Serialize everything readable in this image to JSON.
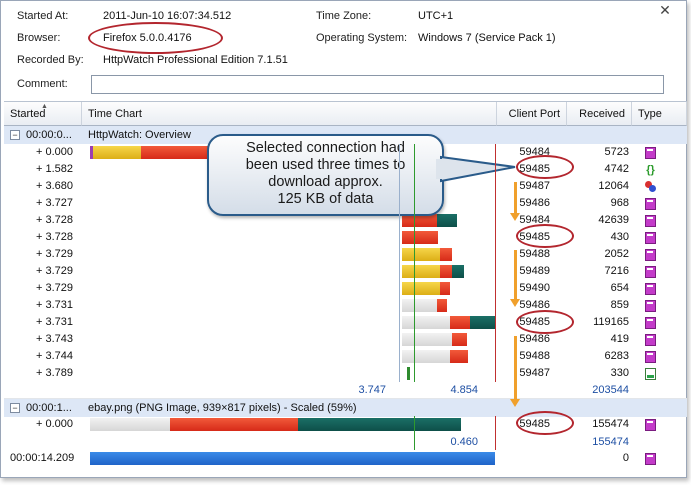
{
  "header": {
    "started_label": "Started At:",
    "started_value": "2011-Jun-10 16:07:34.512",
    "timezone_label": "Time Zone:",
    "timezone_value": "UTC+1",
    "browser_label": "Browser:",
    "browser_value": "Firefox 5.0.0.4176",
    "os_label": "Operating System:",
    "os_value": "Windows 7 (Service Pack 1)",
    "recorded_label": "Recorded By:",
    "recorded_value": "HttpWatch Professional Edition 7.1.51",
    "comment_label": "Comment:",
    "comment_value": ""
  },
  "columns": {
    "started": "Started",
    "timechart": "Time Chart",
    "port": "Client Port",
    "received": "Received",
    "type": "Type"
  },
  "group1": {
    "time": "00:00:0...",
    "title": "HttpWatch: Overview"
  },
  "rows1": [
    {
      "started": "+ 0.000",
      "port": "59484",
      "received": "5723",
      "type_icon": "page-icon"
    },
    {
      "started": "+ 1.582",
      "port": "59485",
      "received": "4742",
      "type_icon": "javascript-icon"
    },
    {
      "started": "+ 3.680",
      "port": "59487",
      "received": "12064",
      "type_icon": "css-icon"
    },
    {
      "started": "+ 3.727",
      "port": "59486",
      "received": "968",
      "type_icon": "image-icon"
    },
    {
      "started": "+ 3.728",
      "port": "59484",
      "received": "42639",
      "type_icon": "image-icon"
    },
    {
      "started": "+ 3.728",
      "port": "59485",
      "received": "430",
      "type_icon": "image-icon"
    },
    {
      "started": "+ 3.729",
      "port": "59488",
      "received": "2052",
      "type_icon": "image-icon"
    },
    {
      "started": "+ 3.729",
      "port": "59489",
      "received": "7216",
      "type_icon": "image-icon"
    },
    {
      "started": "+ 3.729",
      "port": "59490",
      "received": "654",
      "type_icon": "image-icon"
    },
    {
      "started": "+ 3.731",
      "port": "59486",
      "received": "859",
      "type_icon": "image-icon"
    },
    {
      "started": "+ 3.731",
      "port": "59485",
      "received": "119165",
      "type_icon": "image-icon"
    },
    {
      "started": "+ 3.743",
      "port": "59486",
      "received": "419",
      "type_icon": "image-icon"
    },
    {
      "started": "+ 3.744",
      "port": "59488",
      "received": "6283",
      "type_icon": "image-icon"
    },
    {
      "started": "+ 3.789",
      "port": "59487",
      "received": "330",
      "type_icon": "green-image-icon"
    }
  ],
  "summary1": {
    "load1": "3.747",
    "load2": "4.854",
    "received": "203544"
  },
  "group2": {
    "time": "00:00:1...",
    "title": "ebay.png (PNG Image, 939×817 pixels) - Scaled (59%)"
  },
  "rows2": [
    {
      "started": "+ 0.000",
      "port": "59485",
      "received": "155474",
      "type_icon": "image-icon"
    }
  ],
  "summary2": {
    "load": "0.460",
    "received": "155474"
  },
  "footer_row": {
    "started": "00:00:14.209",
    "received": "0",
    "type_icon": "page-icon"
  },
  "callout": {
    "line1": "Selected connection had",
    "line2": "been used three times to",
    "line3": "download approx.",
    "line4": "125 KB of data"
  },
  "colors": {
    "annotation_red": "#b3262e",
    "arrow_orange": "#f0a02c",
    "group_bg": "#dde7f6",
    "summary_blue": "#1e4fa3"
  }
}
